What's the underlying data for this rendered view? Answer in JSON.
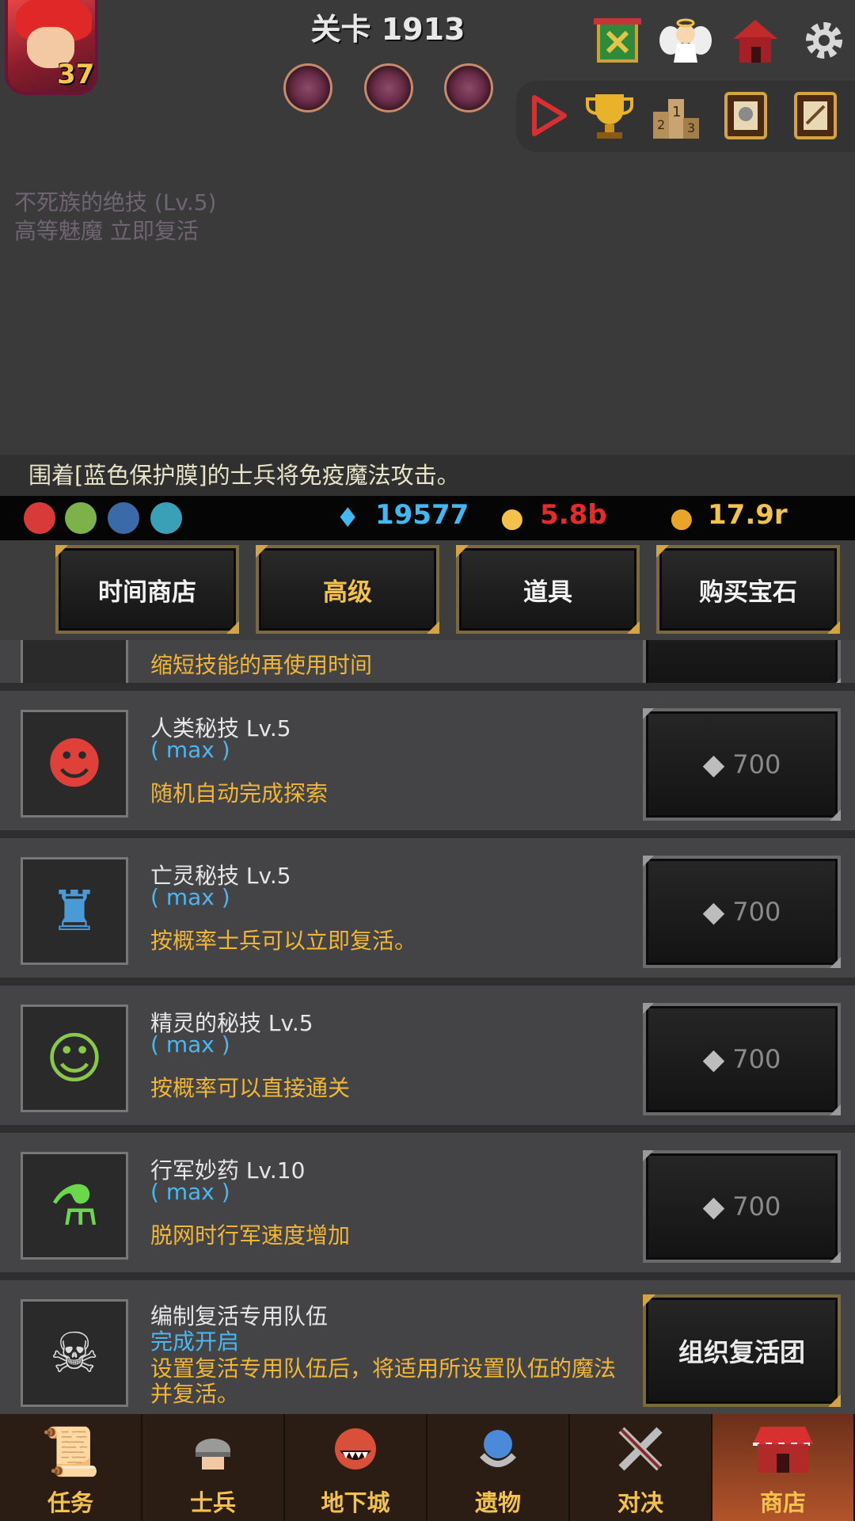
{
  "header": {
    "player_level": "37",
    "stage_title": "关卡 1913",
    "top_icons": [
      "guild-banner-icon",
      "angel-icon",
      "house-icon",
      "gear-icon"
    ],
    "toolbar_icons": [
      "play-icon",
      "trophy-icon",
      "ranking-podium-icon",
      "knight-book-icon",
      "quest-book-icon"
    ]
  },
  "skill_info": {
    "line1": "不死族的绝技 (Lv.5)",
    "line2": "高等魅魔 立即复活"
  },
  "notice": "围着[蓝色保护膜]的士兵将免疫魔法攻击。",
  "resources": {
    "gems": "19577",
    "medals": "5.8b",
    "gold": "17.9r",
    "colors": {
      "gems": "#41b8f2",
      "medals": "#e52a2a",
      "gold": "#f2c24a"
    }
  },
  "tabs": [
    {
      "label": "时间商店",
      "active": false
    },
    {
      "label": "高级",
      "active": true
    },
    {
      "label": "道具",
      "active": false
    },
    {
      "label": "购买宝石",
      "active": false
    }
  ],
  "list": {
    "partial_desc": "缩短技能的再使用时间",
    "items": [
      {
        "title": "人类秘技 Lv.5",
        "status": "( max )",
        "desc": "随机自动完成探索",
        "price": "700",
        "icon": "human-warrior-icon"
      },
      {
        "title": "亡灵秘技 Lv.5",
        "status": "( max )",
        "desc": "按概率士兵可以立即复活。",
        "price": "700",
        "icon": "undead-knight-icon"
      },
      {
        "title": "精灵的秘技 Lv.5",
        "status": "( max )",
        "desc": "按概率可以直接通关",
        "price": "700",
        "icon": "elf-icon"
      },
      {
        "title": "行军妙药 Lv.10",
        "status": "( max )",
        "desc": "脱网时行军速度增加",
        "price": "700",
        "icon": "potion-icon"
      },
      {
        "title": "编制复活专用队伍",
        "status": "完成开启",
        "desc": "设置复活专用队伍后，将适用所设置队伍的魔法并复活。",
        "button": "组织复活团",
        "icon": "skull-book-icon"
      }
    ]
  },
  "nav": [
    {
      "label": "任务",
      "icon": "scroll-icon",
      "active": false
    },
    {
      "label": "士兵",
      "icon": "soldier-helmet-icon",
      "active": false
    },
    {
      "label": "地下城",
      "icon": "dungeon-monster-icon",
      "active": false
    },
    {
      "label": "遗物",
      "icon": "relic-orb-icon",
      "active": false
    },
    {
      "label": "对决",
      "icon": "crossed-swords-icon",
      "active": false
    },
    {
      "label": "商店",
      "icon": "shop-icon",
      "active": true
    }
  ]
}
